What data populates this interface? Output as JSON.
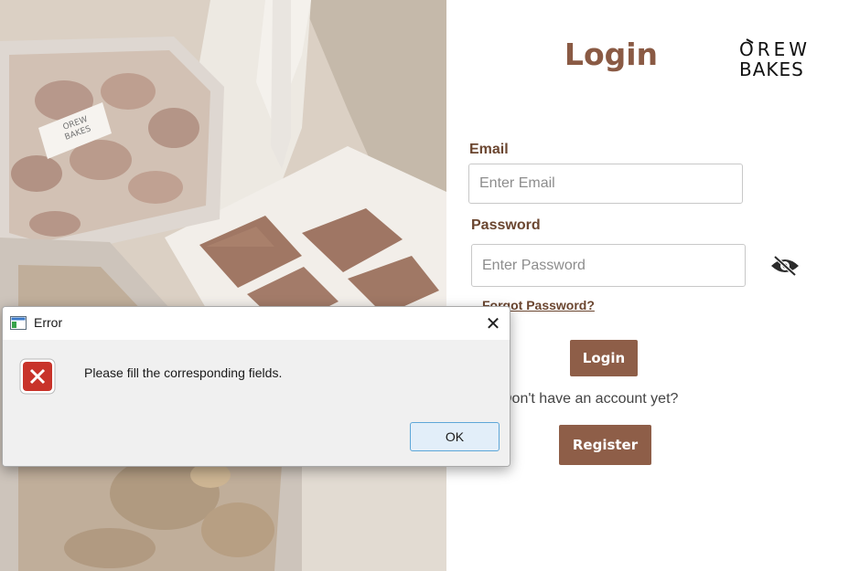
{
  "form": {
    "title": "Login",
    "brand_line1": "OREW",
    "brand_line2": "BAKES",
    "email_label": "Email",
    "email_placeholder": "Enter Email",
    "email_value": "",
    "password_label": "Password",
    "password_placeholder": "Enter Password",
    "password_value": "",
    "forgot_link": "Forgot Password?",
    "login_button": "Login",
    "no_account_text": "Don't have an account yet?",
    "register_button": "Register"
  },
  "dialog": {
    "title": "Error",
    "message": "Please fill the corresponding fields.",
    "ok_button": "OK",
    "close_glyph": "✕"
  },
  "photo": {
    "box_label_line1": "OREW",
    "box_label_line2": "BAKES"
  },
  "icons": {
    "password_toggle": "eye-slash-icon",
    "dialog_app": "window-app-icon",
    "dialog_error": "error-x-icon",
    "dialog_close": "close-icon"
  },
  "colors": {
    "brand_brown": "#8e5e48",
    "title_brown": "#8a5a44",
    "label_brown": "#6b4630",
    "error_red": "#c8332a",
    "ok_border": "#5da6d8"
  }
}
